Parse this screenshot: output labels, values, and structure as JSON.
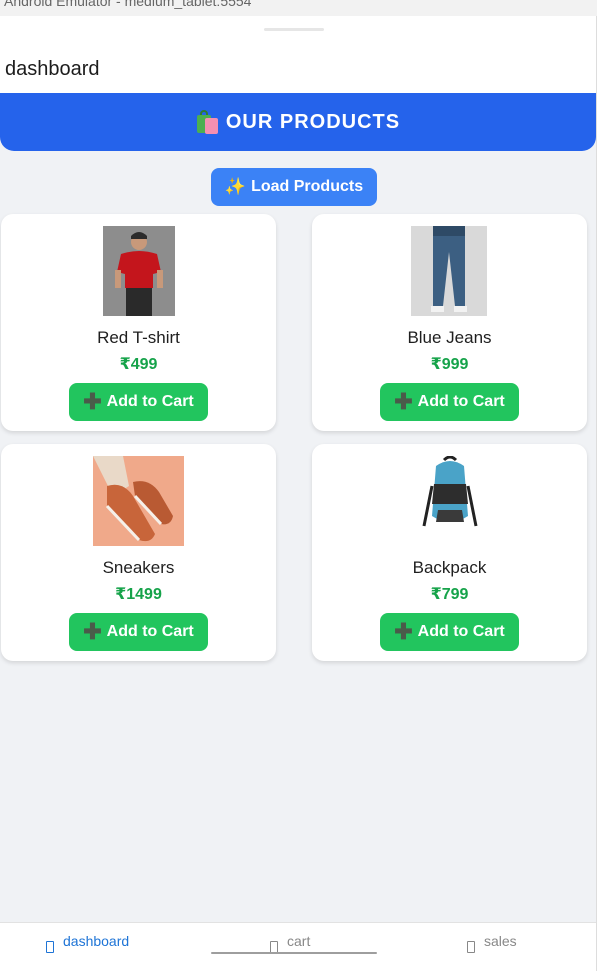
{
  "emulator": {
    "title": "Android Emulator - medium_tablet:5554"
  },
  "header": {
    "title": "dashboard"
  },
  "banner": {
    "icon": "shopping-bags-icon",
    "title": "OUR PRODUCTS"
  },
  "load_button": {
    "icon": "sparkles-icon",
    "label": "Load Products"
  },
  "products": [
    {
      "name": "Red T-shirt",
      "price": "₹499",
      "button": "Add to Cart",
      "image": "red-tshirt-photo"
    },
    {
      "name": "Blue Jeans",
      "price": "₹999",
      "button": "Add to Cart",
      "image": "blue-jeans-photo"
    },
    {
      "name": "Sneakers",
      "price": "₹1499",
      "button": "Add to Cart",
      "image": "sneakers-photo"
    },
    {
      "name": "Backpack",
      "price": "₹799",
      "button": "Add to Cart",
      "image": "backpack-photo"
    }
  ],
  "nav": {
    "items": [
      {
        "label": "dashboard",
        "active": true
      },
      {
        "label": "cart",
        "active": false
      },
      {
        "label": "sales",
        "active": false
      }
    ]
  },
  "colors": {
    "primary": "#2563eb",
    "button_blue": "#3b82f6",
    "button_green": "#22c55e",
    "price_green": "#16a34a",
    "active_nav": "#1e74d6",
    "inactive_nav": "#888888"
  }
}
